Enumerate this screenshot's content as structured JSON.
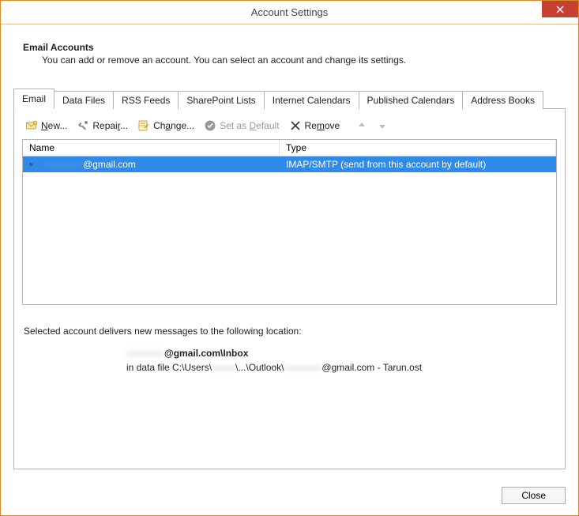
{
  "window": {
    "title": "Account Settings"
  },
  "header": {
    "heading": "Email Accounts",
    "subheading": "You can add or remove an account. You can select an account and change its settings."
  },
  "tabs": [
    {
      "label": "Email"
    },
    {
      "label": "Data Files"
    },
    {
      "label": "RSS Feeds"
    },
    {
      "label": "SharePoint Lists"
    },
    {
      "label": "Internet Calendars"
    },
    {
      "label": "Published Calendars"
    },
    {
      "label": "Address Books"
    }
  ],
  "toolbar": {
    "new_pre": "",
    "new_u": "N",
    "new_post": "ew...",
    "repair_pre": "Repai",
    "repair_u": "r",
    "repair_post": "...",
    "change_pre": "Ch",
    "change_u": "a",
    "change_post": "nge...",
    "default_pre": "Set as ",
    "default_u": "D",
    "default_post": "efault",
    "remove_pre": "Re",
    "remove_u": "m",
    "remove_post": "ove"
  },
  "list": {
    "col_name": "Name",
    "col_type": "Type",
    "rows": [
      {
        "name_hidden": "xxxxxxxx",
        "name_suffix": "@gmail.com",
        "type": "IMAP/SMTP (send from this account by default)"
      }
    ]
  },
  "delivery": {
    "intro": "Selected account delivers new messages to the following location:",
    "loc_hidden1": "xxxxxxxx",
    "loc_bold": "@gmail.com\\Inbox",
    "file_pre": "in data file C:\\Users\\",
    "file_hidden1": "xxxxx",
    "file_mid": "\\...\\Outlook\\",
    "file_hidden2": "xxxxxxxx",
    "file_post": "@gmail.com - Tarun.ost"
  },
  "footer": {
    "close": "Close"
  }
}
